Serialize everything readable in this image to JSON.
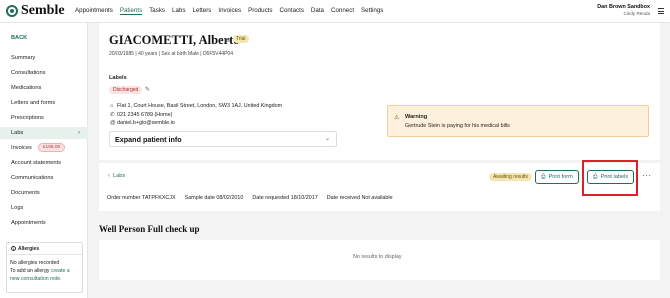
{
  "app": {
    "name": "Semble",
    "brand_color": "#1f6f5c"
  },
  "nav": {
    "items": [
      "Appointments",
      "Patients",
      "Tasks",
      "Labs",
      "Letters",
      "Invoices",
      "Products",
      "Contacts",
      "Data",
      "Connect",
      "Settings"
    ],
    "active": "Patients"
  },
  "user": {
    "name": "Dan Brown Sandbox",
    "org": "Cindy Renda"
  },
  "sidebar": {
    "back": "BACK",
    "items": [
      {
        "label": "Summary"
      },
      {
        "label": "Consultations"
      },
      {
        "label": "Medications"
      },
      {
        "label": "Letters and forms"
      },
      {
        "label": "Prescriptions"
      },
      {
        "label": "Labs"
      },
      {
        "label": "Invoices",
        "badge": "£185.00"
      },
      {
        "label": "Account statements"
      },
      {
        "label": "Communications"
      },
      {
        "label": "Documents"
      },
      {
        "label": "Logs"
      },
      {
        "label": "Appointments"
      }
    ],
    "active": "Labs",
    "allergies": {
      "title": "Allergies",
      "none": "No allergies recorded",
      "add_prefix": "To add an allergy ",
      "add_link": "create a new consultation note."
    }
  },
  "patient": {
    "name": "GIACOMETTI, Alberto",
    "title": "Mr",
    "tag": "Trial",
    "meta": "20/03/1985 | 40 years | Sex at birth Male | D6F5V44P04",
    "labels_heading": "Labels",
    "label_badge": "Discharged",
    "address": "Flat 1, Court House, Basil Street, London, SW3 1AJ, United Kingdom",
    "phone": "021 2345 6789 (Home)",
    "email": "daniel.b+glo@semble.io",
    "expand_label": "Expand patient info"
  },
  "warning": {
    "title": "Warning",
    "body": "Gertrude Stein is paying for his medical bills"
  },
  "lab": {
    "back_link": "Labs",
    "status": "Awaiting results",
    "print_form": "Print form",
    "print_labels": "Print labels",
    "more": "···",
    "order_number": "Order number  TATPFKXCJX",
    "sample_date": "Sample date  08/02/2010",
    "date_requested": "Date requested  18/10/2017",
    "date_received": "Date received  Not available"
  },
  "test": {
    "title": "Well Person Full check up",
    "empty": "No results to display"
  }
}
